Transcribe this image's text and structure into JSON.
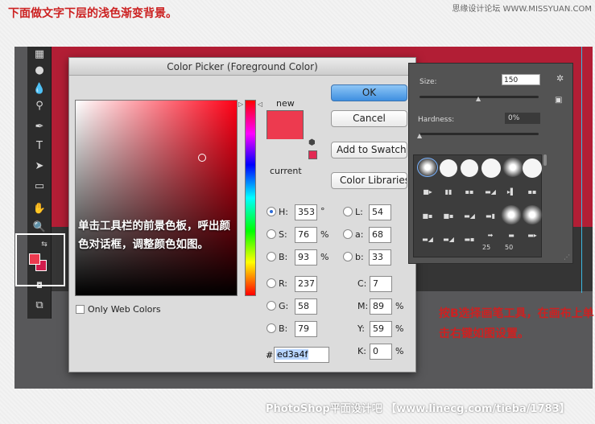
{
  "page": {
    "title": "下面做文字下层的浅色渐变背景。",
    "watermark": "思缘设计论坛 WWW.MISSYUAN.COM",
    "footer": "PhotoShop平面设计吧 【www.linecg.com/tieba/1783】"
  },
  "toolbar": {
    "icons": [
      "gradient-tool-icon",
      "blur-tool-icon",
      "dodge-tool-icon",
      "pen-tool-icon",
      "type-tool-icon",
      "path-selection-icon",
      "rectangle-tool-icon",
      "hand-tool-icon",
      "zoom-tool-icon",
      "swap-colors-icon",
      "quick-mask-icon",
      "screen-mode-icon"
    ],
    "fg_color": "#ed3a4f",
    "bg_color": "#d21d4d"
  },
  "dialog": {
    "title": "Color Picker (Foreground Color)",
    "new_label": "new",
    "current_label": "current",
    "buttons": {
      "ok": "OK",
      "cancel": "Cancel",
      "add_swatches": "Add to Swatches",
      "color_libraries": "Color Libraries"
    },
    "fields_hsb_rgb": [
      {
        "label": "H:",
        "value": "353",
        "unit": "°",
        "selected": true
      },
      {
        "label": "S:",
        "value": "76",
        "unit": "%",
        "selected": false
      },
      {
        "label": "B:",
        "value": "93",
        "unit": "%",
        "selected": false
      },
      {
        "label": "R:",
        "value": "237",
        "unit": "",
        "selected": false
      },
      {
        "label": "G:",
        "value": "58",
        "unit": "",
        "selected": false
      },
      {
        "label": "B:",
        "value": "79",
        "unit": "",
        "selected": false
      }
    ],
    "fields_lab": [
      {
        "label": "L:",
        "value": "54"
      },
      {
        "label": "a:",
        "value": "68"
      },
      {
        "label": "b:",
        "value": "33"
      }
    ],
    "fields_cmyk": [
      {
        "label": "C:",
        "value": "7",
        "unit": "%"
      },
      {
        "label": "M:",
        "value": "89",
        "unit": "%"
      },
      {
        "label": "Y:",
        "value": "59",
        "unit": "%"
      },
      {
        "label": "K:",
        "value": "0",
        "unit": "%"
      }
    ],
    "only_web_colors": "Only Web Colors",
    "hex_label": "#",
    "hex_value": "ed3a4f",
    "new_color": "#ed3a4f",
    "current_color": "#ed3a4f"
  },
  "brush_panel": {
    "size_label": "Size:",
    "size_value": "150",
    "size_level": 0.5,
    "hardness_label": "Hardness:",
    "hardness_value": "0%",
    "preset_labels": [
      "25",
      "50"
    ]
  },
  "annotations": {
    "foreground_note": "单击工具栏的前景色板，呼出颜色对话框，调整颜色如图。",
    "brush_note": "按B选择画笔工具，在画布上单击右键如图设置。"
  }
}
